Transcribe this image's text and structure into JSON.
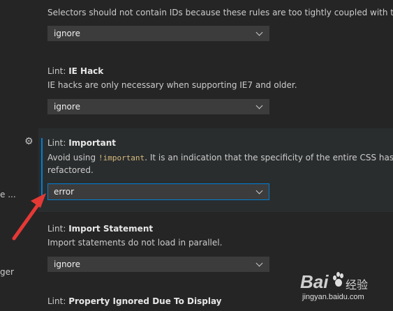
{
  "left_fragments": [
    "e ...",
    "ger"
  ],
  "settings": [
    {
      "category": "",
      "name": "",
      "description": "Selectors should not contain IDs because these rules are too tightly coupled with the H",
      "value": "ignore"
    },
    {
      "category": "Lint: ",
      "name": "IE Hack",
      "description": "IE hacks are only necessary when supporting IE7 and older.",
      "value": "ignore"
    },
    {
      "category": "Lint: ",
      "name": "Important",
      "description_before": "Avoid using ",
      "description_code": "!important",
      "description_after": ". It is an indication that the specificity of the entire CSS has go",
      "description_line2": "refactored.",
      "value": "error"
    },
    {
      "category": "Lint: ",
      "name": "Import Statement",
      "description": "Import statements do not load in parallel.",
      "value": "ignore"
    },
    {
      "category": "Lint: ",
      "name": "Property Ignored Due To Display",
      "description": "",
      "value": ""
    }
  ],
  "icons": {
    "gear": "gear-icon",
    "dropdown": "chevron-down-icon"
  },
  "colors": {
    "background": "#252526",
    "focused_background": "#2a2d2e",
    "focus_border": "#007fd4",
    "dropdown_background": "#3c3c3c",
    "arrow": "#e53935"
  },
  "watermark": {
    "logo_text": "Bai",
    "cn_text": "经验",
    "url": "jingyan.baidu.com"
  }
}
